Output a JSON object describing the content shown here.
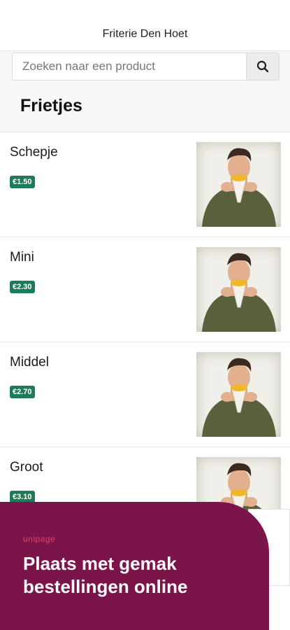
{
  "header": {
    "title": "Friterie Den Hoet"
  },
  "search": {
    "placeholder": "Zoeken naar een product",
    "icon": "search-icon"
  },
  "category": {
    "title": "Frietjes"
  },
  "products": [
    {
      "name": "Schepje",
      "price": "€1.50"
    },
    {
      "name": "Mini",
      "price": "€2.30"
    },
    {
      "name": "Middel",
      "price": "€2.70"
    },
    {
      "name": "Groot",
      "price": "€3.10"
    }
  ],
  "promo": {
    "logo": "unipage",
    "text": "Plaats met gemak bestellingen online"
  },
  "colors": {
    "accent": "#7a1449",
    "price_badge": "#1f7a5a",
    "logo": "#e0436f"
  }
}
